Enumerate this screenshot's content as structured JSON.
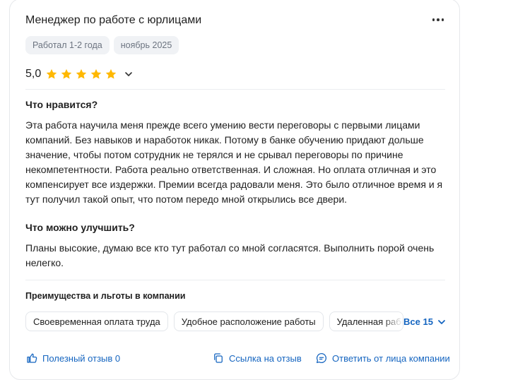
{
  "review": {
    "title": "Менеджер по работе с юрлицами",
    "tags": [
      "Работал 1-2 года",
      "ноябрь 2025"
    ],
    "rating": "5,0",
    "stars": 5,
    "likes_title": "Что нравится?",
    "likes_text": "Эта работа научила меня прежде всего умению вести переговоры с первыми лицами компаний. Без навыков и наработок никак. Потому в банке обучению придают дольше значение, чтобы потом сотрудник не терялся и не срывал переговоры по причине некомпетентности. Работа реально ответственная. И сложная. Но оплата отличная и это компенсирует все издержки. Премии всегда радовали меня. Это было отличное время и я тут получил такой опыт, что потом передо мной открылись все двери.",
    "improve_title": "Что можно улучшить?",
    "improve_text": "Планы высокие, думаю все кто тут работал со мной согласятся. Выполнить порой очень нелегко."
  },
  "benefits": {
    "title": "Преимущества и льготы в компании",
    "items": [
      "Своевременная оплата труда",
      "Удобное расположение работы",
      "Удаленная работа"
    ],
    "all_label": "Все 15"
  },
  "footer": {
    "helpful_label": "Полезный отзыв 0",
    "link_label": "Ссылка на отзыв",
    "reply_label": "Ответить от лица компании"
  },
  "colors": {
    "star": "#ffb800",
    "link": "#1565c0",
    "chip_bg": "#f0f2f5",
    "chip_text": "#6c7480"
  },
  "icons": {
    "more": "more-horizontal-icon",
    "star": "star-icon",
    "chevron": "chevron-down-icon",
    "thumb": "thumb-up-icon",
    "copy": "copy-icon",
    "reply": "chat-bubble-icon"
  }
}
